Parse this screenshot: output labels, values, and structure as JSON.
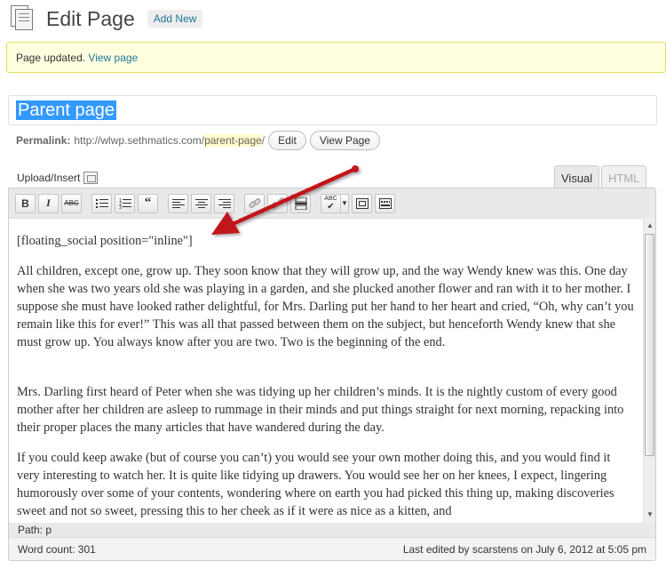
{
  "header": {
    "title": "Edit Page",
    "add_new": "Add New"
  },
  "notice": {
    "text": "Page updated.",
    "link": "View page"
  },
  "title_field": {
    "value": "Parent page"
  },
  "permalink": {
    "label": "Permalink:",
    "base": "http://wlwp.sethmatics.com/",
    "slug": "parent-page",
    "trail": "/",
    "edit_label": "Edit",
    "view_label": "View Page"
  },
  "upload": {
    "label": "Upload/Insert"
  },
  "tabs": {
    "visual": "Visual",
    "html": "HTML"
  },
  "toolbar": {
    "bold": "B",
    "italic": "I",
    "strike": "ABC",
    "bullets": "bullet-list-icon",
    "numbered": "numbered-list-icon",
    "quote": "blockquote-icon",
    "align_left": "align-left-icon",
    "align_center": "align-center-icon",
    "align_right": "align-right-icon",
    "link": "link-icon",
    "unlink": "unlink-icon",
    "more": "more-tag-icon",
    "spellcheck": "ABC",
    "fullscreen": "fullscreen-icon",
    "kitchen_sink": "kitchen-sink-icon"
  },
  "content": {
    "shortcode": "[floating_social position=\"inline\"]",
    "p1": "All children, except one, grow up. They soon know that they will grow up, and the way Wendy knew was this. One day when she was two years old she was playing in a garden, and she plucked another flower and ran with it to her mother. I suppose she must have looked rather delightful, for Mrs. Darling put her hand to her heart and cried, “Oh, why can’t you remain like this for ever!” This was all that passed between them on the subject, but henceforth Wendy knew that she must grow up. You always know after you are two. Two is the beginning of the end.",
    "p2": "Mrs. Darling first heard of Peter when she was tidying up her children’s minds. It is the nightly custom of every good mother after her children are asleep to rummage in their minds and put things straight for next morning, repacking into their proper places the many articles that have wandered during the day.",
    "p3": "If you could keep awake (but of course you can’t) you would see your own mother doing this, and you would find it very interesting to watch her. It is quite like tidying up drawers. You would see her on her knees, I expect, lingering humorously over some of your contents, wondering where on earth you had picked this thing up, making discoveries sweet and not so sweet, pressing this to her cheek as if it were as nice as a kitten, and"
  },
  "path": {
    "label": "Path:",
    "value": "p"
  },
  "status": {
    "word_count": "Word count: 301",
    "last_edited": "Last edited by scarstens on July 6, 2012 at 5:05 pm"
  },
  "colors": {
    "accent_link": "#21759b",
    "notice_bg": "#ffffe0",
    "annotation_arrow": "#c1141a",
    "selection": "#3399ff"
  }
}
